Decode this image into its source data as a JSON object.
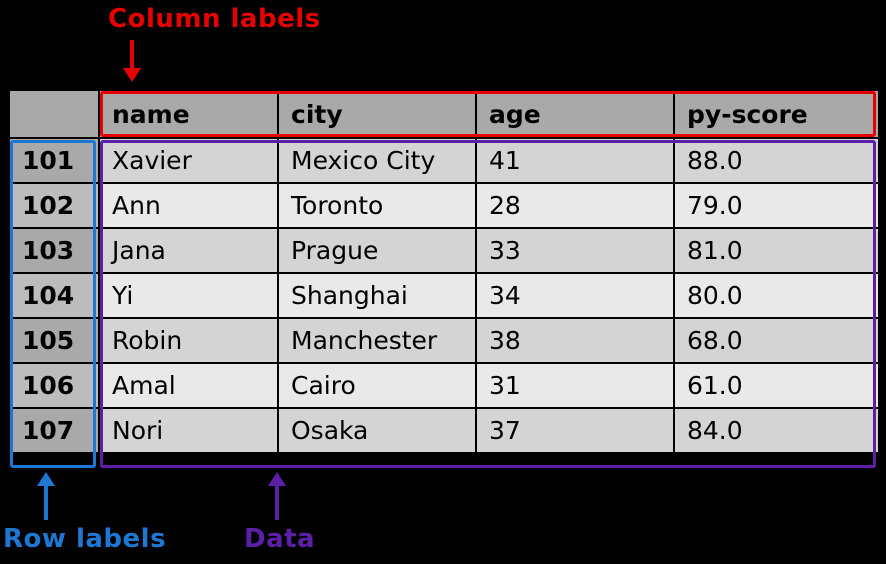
{
  "annotations": {
    "columns_label": "Column labels",
    "rows_label": "Row labels",
    "data_label": "Data"
  },
  "table": {
    "columns": [
      "name",
      "city",
      "age",
      "py-score"
    ],
    "index": [
      "101",
      "102",
      "103",
      "104",
      "105",
      "106",
      "107"
    ],
    "rows": [
      {
        "name": "Xavier",
        "city": "Mexico City",
        "age": "41",
        "pyscore": "88.0"
      },
      {
        "name": "Ann",
        "city": "Toronto",
        "age": "28",
        "pyscore": "79.0"
      },
      {
        "name": "Jana",
        "city": "Prague",
        "age": "33",
        "pyscore": "81.0"
      },
      {
        "name": "Yi",
        "city": "Shanghai",
        "age": "34",
        "pyscore": "80.0"
      },
      {
        "name": "Robin",
        "city": "Manchester",
        "age": "38",
        "pyscore": "68.0"
      },
      {
        "name": "Amal",
        "city": "Cairo",
        "age": "31",
        "pyscore": "61.0"
      },
      {
        "name": "Nori",
        "city": "Osaka",
        "age": "37",
        "pyscore": "84.0"
      }
    ]
  },
  "chart_data": {
    "type": "table",
    "title": "",
    "columns": [
      "name",
      "city",
      "age",
      "py-score"
    ],
    "index": [
      101,
      102,
      103,
      104,
      105,
      106,
      107
    ],
    "data": [
      [
        "Xavier",
        "Mexico City",
        41,
        88.0
      ],
      [
        "Ann",
        "Toronto",
        28,
        79.0
      ],
      [
        "Jana",
        "Prague",
        33,
        81.0
      ],
      [
        "Yi",
        "Shanghai",
        34,
        80.0
      ],
      [
        "Robin",
        "Manchester",
        38,
        68.0
      ],
      [
        "Amal",
        "Cairo",
        31,
        61.0
      ],
      [
        "Nori",
        "Osaka",
        37,
        84.0
      ]
    ],
    "annotations": {
      "column_labels_box": "red",
      "row_labels_box": "blue",
      "data_box": "purple"
    }
  }
}
